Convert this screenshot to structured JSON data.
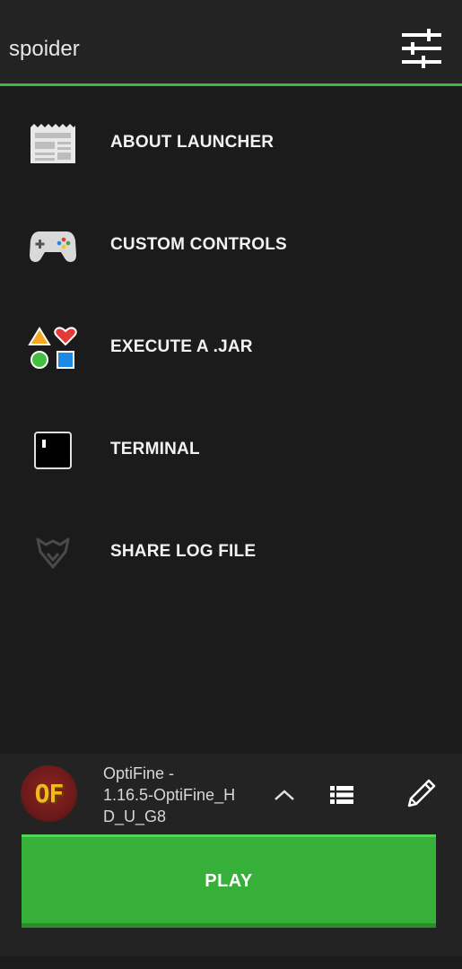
{
  "header": {
    "username": "spoider",
    "settings_icon": "sliders-icon"
  },
  "menu": {
    "items": [
      {
        "label": "ABOUT LAUNCHER",
        "icon": "news-icon"
      },
      {
        "label": "CUSTOM CONTROLS",
        "icon": "gamepad-icon"
      },
      {
        "label": "EXECUTE A .JAR",
        "icon": "shapes-icon"
      },
      {
        "label": "TERMINAL",
        "icon": "terminal-icon"
      },
      {
        "label": "SHARE LOG FILE",
        "icon": "share-log-icon"
      }
    ]
  },
  "profile": {
    "avatar_text": "OF",
    "version_name": "OptiFine - 1.16.5-OptiFine_HD_U_G8",
    "version_line1": "OptiFine -",
    "version_line2": "1.16.5-OptiFine_H",
    "version_line3": "D_U_G8"
  },
  "actions": {
    "expand_icon": "chevron-up-icon",
    "list_icon": "list-icon",
    "edit_icon": "pencil-icon",
    "play_label": "PLAY"
  },
  "colors": {
    "accent": "#3fb63c",
    "play": "#37b03a",
    "background": "#1b1b1b",
    "panel": "#232323"
  }
}
